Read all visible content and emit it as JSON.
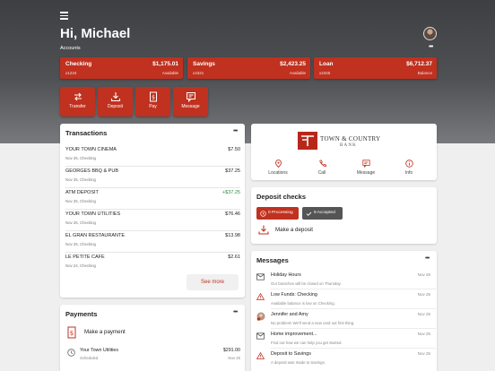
{
  "header": {
    "greeting": "Hi, Michael",
    "accounts_label": "Accounts",
    "more": "•••"
  },
  "accounts": [
    {
      "name": "Checking",
      "number": "x1234",
      "amount": "$1,175.01",
      "sub": "Available"
    },
    {
      "name": "Savings",
      "number": "x4321",
      "amount": "$2,423.25",
      "sub": "Available"
    },
    {
      "name": "Loan",
      "number": "x2345",
      "amount": "$6,712.37",
      "sub": "Balance"
    }
  ],
  "actions": [
    {
      "label": "Transfer",
      "icon": "transfer-icon"
    },
    {
      "label": "Deposit",
      "icon": "deposit-icon"
    },
    {
      "label": "Pay",
      "icon": "pay-icon"
    },
    {
      "label": "Message",
      "icon": "message-icon"
    }
  ],
  "transactions": {
    "title": "Transactions",
    "more": "•••",
    "items": [
      {
        "name": "YOUR TOWN CINEMA",
        "sub": "Nov 25, Checking",
        "amount": "$7.50",
        "positive": false
      },
      {
        "name": "GEORGES BBQ & PUB",
        "sub": "Nov 25, Checking",
        "amount": "$37.25",
        "positive": false
      },
      {
        "name": "ATM DEPOSIT",
        "sub": "Nov 25, Checking",
        "amount": "+$37.25",
        "positive": true
      },
      {
        "name": "YOUR TOWN UTILITIES",
        "sub": "Nov 25, Checking",
        "amount": "$76.46",
        "positive": false
      },
      {
        "name": "EL GRAN RESTAURANTE",
        "sub": "Nov 25, Checking",
        "amount": "$13.98",
        "positive": false
      },
      {
        "name": "LE PETITE CAFE",
        "sub": "Nov 24, Checking",
        "amount": "$2.61",
        "positive": false
      }
    ],
    "see_more": "See more"
  },
  "payments": {
    "title": "Payments",
    "more": "•••",
    "make_payment": "Make a payment",
    "item_name": "Your Town Utilities",
    "item_sub": "Scheduled",
    "item_amount": "$291.00",
    "item_date": "Nov 25"
  },
  "bank": {
    "name_line1": "TOWN & COUNTRY",
    "name_line2": "BANK",
    "quick_links": [
      {
        "label": "Locations",
        "icon": "location-icon"
      },
      {
        "label": "Call",
        "icon": "phone-icon"
      },
      {
        "label": "Message",
        "icon": "message-icon"
      },
      {
        "label": "Info",
        "icon": "info-icon"
      }
    ]
  },
  "deposit_checks": {
    "title": "Deposit checks",
    "processing": "0 Processing",
    "accepted": "9 Accepted",
    "make_deposit": "Make a deposit"
  },
  "messages": {
    "title": "Messages",
    "more": "•••",
    "items": [
      {
        "title": "Holiday Hours",
        "sub": "Our branches will be closed on Thursday.",
        "date": "Nov 25",
        "icon": "mail-icon"
      },
      {
        "title": "Low Funds: Checking",
        "sub": "Available balance is low on Checking.",
        "date": "Nov 25",
        "icon": "warning-icon"
      },
      {
        "title": "Jennifer and Amy",
        "sub": "No problem! We'll send a new card out first thing.",
        "date": "Nov 25",
        "icon": "chat-avatar-icon"
      },
      {
        "title": "Home improvement...",
        "sub": "Find out how we can help you get started.",
        "date": "Nov 25",
        "icon": "mail-icon"
      },
      {
        "title": "Deposit to Savings",
        "sub": "A deposit was made to Savings.",
        "date": "Nov 25",
        "icon": "warning-icon"
      }
    ]
  },
  "colors": {
    "accent": "#c0311f",
    "positive": "#2e8b3a",
    "processing": "#c0311f",
    "accepted": "#555555"
  }
}
